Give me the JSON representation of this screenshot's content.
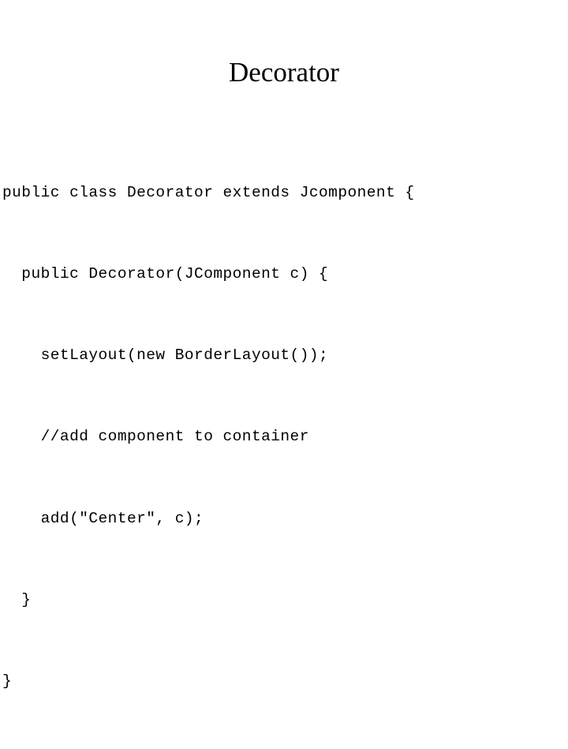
{
  "slide": {
    "title": "Decorator",
    "background_color": "#ffffff",
    "text_color": "#000000",
    "code": {
      "lines": [
        "public class Decorator extends Jcomponent {",
        "  public Decorator(JComponent c) {",
        "    setLayout(new BorderLayout());",
        "    //add component to container",
        "    add(\"Center\", c);",
        "  }",
        "}"
      ]
    }
  }
}
